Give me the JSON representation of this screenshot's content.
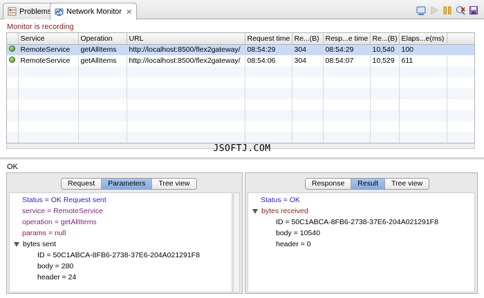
{
  "tabs": [
    {
      "label": "Problems",
      "icon": "problems-icon"
    },
    {
      "label": "Network Monitor",
      "icon": "network-monitor-icon"
    }
  ],
  "toolbar": {
    "icons": [
      "clear-entries-icon",
      "resume-icon",
      "suspend-icon",
      "disable-monitor-icon",
      "save-icon"
    ]
  },
  "monitor_status": "Monitor is recording",
  "table": {
    "columns": [
      "Service",
      "Operation",
      "URL",
      "Request time",
      "Re...(B)",
      "Resp...e time",
      "Re...(B)",
      "Elaps...e(ms)"
    ],
    "rows": [
      {
        "service": "RemoteService",
        "operation": "getAllItems",
        "url": "http://localhost:8500/flex2gateway/",
        "request_time": "08:54:29",
        "req_size": "304",
        "response_time": "08:54:29",
        "resp_size": "10,540",
        "elapsed": "100"
      },
      {
        "service": "RemoteService",
        "operation": "getAllItems",
        "url": "http://localhost:8500/flex2gateway/",
        "request_time": "08:54:06",
        "req_size": "304",
        "response_time": "08:54:07",
        "resp_size": "10,529",
        "elapsed": "611"
      }
    ]
  },
  "watermark": "JSOFTJ.COM",
  "ok_label": "OK",
  "request_pane": {
    "tabs": [
      "Request",
      "Parameters",
      "Tree view"
    ],
    "active_tab": "Parameters",
    "lines": {
      "status": "Status = OK Request sent",
      "service": "service = RemoteService",
      "operation": "operation = getAllItems",
      "params": "params = null",
      "bytes_sent": "bytes sent",
      "id": "ID = 50C1ABCA-8FB6-2738-37E6-204A021291F8",
      "body": "body = 280",
      "header": "header = 24"
    }
  },
  "response_pane": {
    "tabs": [
      "Response",
      "Result",
      "Tree view"
    ],
    "active_tab": "Result",
    "lines": {
      "status": "Status = OK",
      "bytes_received": "bytes received",
      "id": "ID = 50C1ABCA-8FB6-2738-37E6-204A021291F8",
      "body": "body = 10540",
      "header": "header = 0"
    }
  }
}
